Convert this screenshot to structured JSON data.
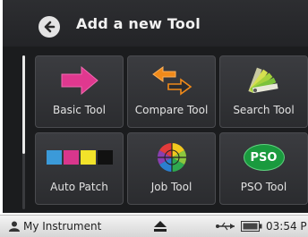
{
  "header": {
    "title": "Add a new Tool"
  },
  "tools": [
    {
      "label": "Basic Tool",
      "icon": "pink-arrow-right-icon"
    },
    {
      "label": "Compare Tool",
      "icon": "orange-compare-arrows-icon"
    },
    {
      "label": "Search Tool",
      "icon": "color-fan-deck-icon"
    },
    {
      "label": "Auto Patch",
      "icon": "color-patch-strip-icon"
    },
    {
      "label": "Job Tool",
      "icon": "color-wheel-crosshair-icon"
    },
    {
      "label": "PSO Tool",
      "icon": "pso-badge-icon",
      "badge_text": "PSO"
    }
  ],
  "statusbar": {
    "instrument": "My Instrument",
    "time": "03:54 P"
  },
  "colors": {
    "background": "#1b1c1e",
    "tile": "#333438",
    "pink": "#e0388f",
    "orange": "#f08a1a",
    "pso_green": "#1a9a3e"
  }
}
